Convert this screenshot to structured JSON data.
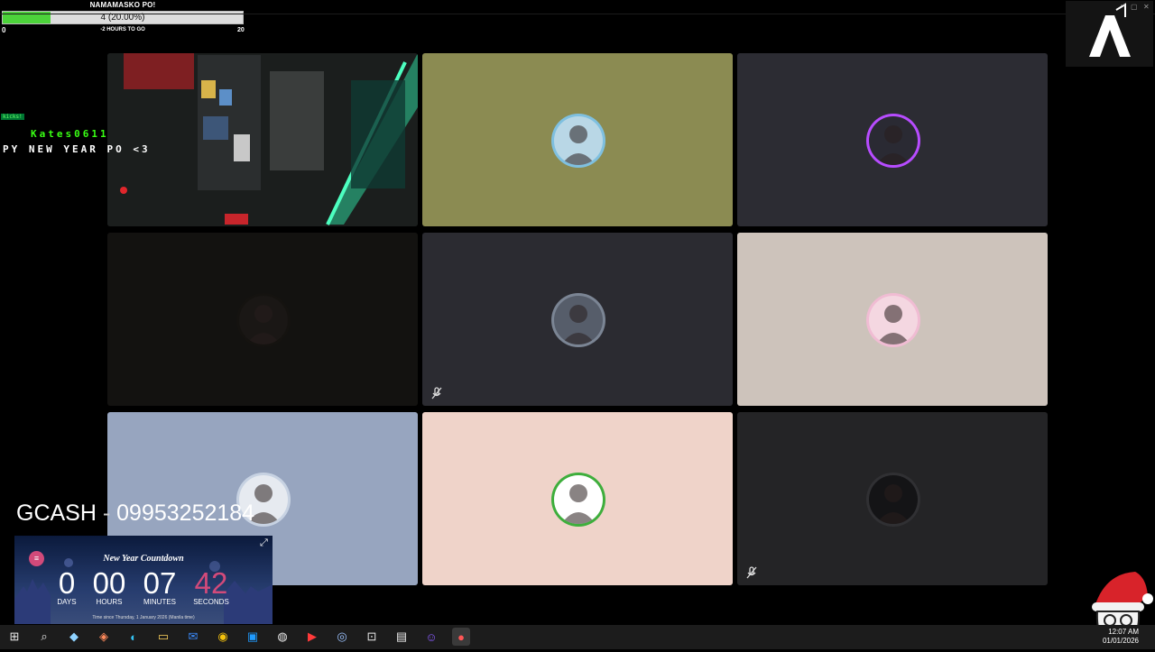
{
  "goal": {
    "title": "NAMAMASKO PO!",
    "value_text": "4 (20.00%)",
    "progress": 0.2,
    "min": "0",
    "max": "20",
    "remaining": "-2 HOURS TO GO"
  },
  "window_controls": {
    "minimize": "–",
    "maximize": "▢",
    "close": "✕"
  },
  "tiles": [
    {
      "name": "tile-camera-shelves",
      "bg": "#1a1d1c",
      "type": "video"
    },
    {
      "name": "tile-olive",
      "bg": "#8b8b52",
      "avatar_bg": "#b9d7e6",
      "ring": "#7fc0e0"
    },
    {
      "name": "tile-dark-purple",
      "bg": "#2c2c33",
      "avatar_bg": "#2a2a33",
      "ring": "#b74cff"
    },
    {
      "name": "tile-dark-woman",
      "bg": "#131210",
      "avatar_bg": "#1a1715",
      "ring": "#151310"
    },
    {
      "name": "tile-muted-man",
      "bg": "#2b2b31",
      "avatar_bg": "#565d6a",
      "ring": "#7b8594",
      "muted": true
    },
    {
      "name": "tile-beige",
      "bg": "#cdc3bb",
      "avatar_bg": "#f4d7e1",
      "ring": "#f0bcd3"
    },
    {
      "name": "tile-blue-grey",
      "bg": "#97a5bf",
      "avatar_bg": "#e6eaf0",
      "ring": "#c7d2e2"
    },
    {
      "name": "tile-pink",
      "bg": "#efd3c9",
      "avatar_bg": "#ffffff",
      "ring": "#3eae3c"
    },
    {
      "name": "tile-dark-mask",
      "bg": "#242426",
      "avatar_bg": "#141416",
      "ring": "#303033",
      "muted": true
    }
  ],
  "alert": {
    "badge": "kicks!",
    "username": "Kates0611",
    "message": "PY NEW YEAR PO <3"
  },
  "gcash": {
    "label": "GCASH",
    "separator": "-",
    "number": "09953252184"
  },
  "countdown": {
    "title": "New Year Countdown",
    "days": "0",
    "hours": "00",
    "minutes": "07",
    "seconds": "42",
    "days_label": "DAYS",
    "hours_label": "HOURS",
    "minutes_label": "MINUTES",
    "seconds_label": "SECONDS",
    "footer": "Time since Thursday, 1 January 2026 (Manila time)",
    "seconds_color": "#d24a7a"
  },
  "taskbar": {
    "icons": [
      "windows-start-icon",
      "search-icon",
      "copilot-icon",
      "microsoft365-icon",
      "edge-icon",
      "file-explorer-icon",
      "mail-icon",
      "chrome-icon",
      "store-icon",
      "app-icon",
      "video-editor-icon",
      "steam-icon",
      "app-grid-icon",
      "files-icon",
      "discord-icon",
      "obs-icon"
    ],
    "time": "12:07 AM",
    "date": "01/01/2026"
  }
}
